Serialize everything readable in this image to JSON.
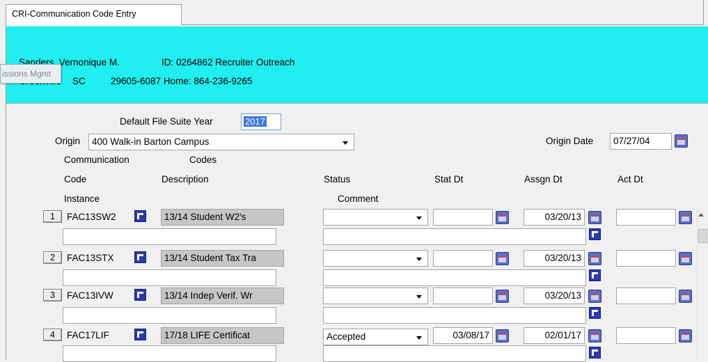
{
  "tab": {
    "label": "CRI-Communication Code Entry"
  },
  "header": {
    "name": "Sanders,  Vernonique M.",
    "id_line": "ID: 0264862 Recruiter Outreach",
    "city": "Greenville",
    "state": "SC",
    "zip_phone": "29605-6087  Home: 864-236-9265",
    "ghost_tooltip": "issions Mgmt",
    "bg_color": "#21eef0"
  },
  "form": {
    "default_year_label": "Default File Suite Year",
    "default_year_value": "2017",
    "origin_label": "Origin",
    "origin_value": "400 Walk-in Barton Campus",
    "origin_date_label": "Origin Date",
    "origin_date_value": "07/27/04"
  },
  "columns": {
    "communication": "Communication",
    "codes": "Codes",
    "code": "Code",
    "description": "Description",
    "status": "Status",
    "stat_dt": "Stat Dt",
    "assgn_dt": "Assgn Dt",
    "act_dt": "Act Dt",
    "instance": "Instance",
    "comment": "Comment"
  },
  "rows": [
    {
      "num": "1",
      "code": "FAC13SW2",
      "description": "13/14 Student W2's",
      "status": "",
      "stat_dt": "",
      "assgn_dt": "03/20/13",
      "act_dt": ""
    },
    {
      "num": "2",
      "code": "FAC13STX",
      "description": "13/14 Student Tax Tra",
      "status": "",
      "stat_dt": "",
      "assgn_dt": "03/20/13",
      "act_dt": ""
    },
    {
      "num": "3",
      "code": "FAC13IVW",
      "description": "13/14 Indep Verif. Wr",
      "status": "",
      "stat_dt": "",
      "assgn_dt": "03/20/13",
      "act_dt": ""
    },
    {
      "num": "4",
      "code": "FAC17LIF",
      "description": "17/18 LIFE Certificat",
      "status": "Accepted",
      "stat_dt": "03/08/17",
      "assgn_dt": "02/01/17",
      "act_dt": ""
    }
  ]
}
